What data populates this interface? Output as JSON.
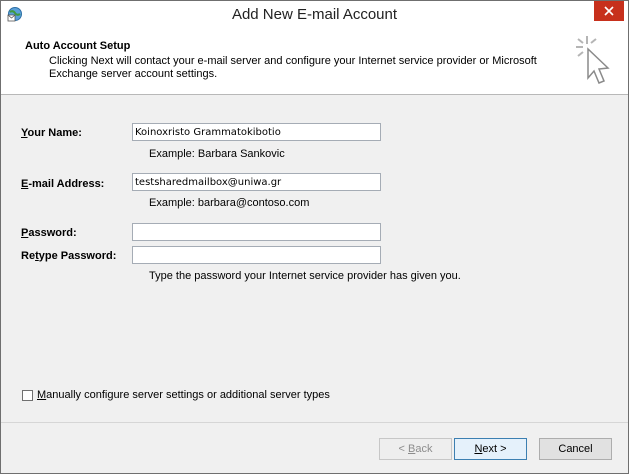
{
  "window": {
    "title": "Add New E-mail Account"
  },
  "header": {
    "title": "Auto Account Setup",
    "description": "Clicking Next will contact your e-mail server and configure your Internet service provider or Microsoft Exchange server account settings."
  },
  "form": {
    "name": {
      "label": "Your Name:",
      "value": "Koinoxristo Grammatokibotio",
      "hint": "Example: Barbara Sankovic"
    },
    "email": {
      "label": "E-mail Address:",
      "value": "testsharedmailbox@uniwa.gr",
      "hint": "Example: barbara@contoso.com"
    },
    "password": {
      "label": "Password:",
      "value": ""
    },
    "retype": {
      "label": "Retype Password:",
      "value": ""
    },
    "password_hint": "Type the password your Internet service provider has given you."
  },
  "manual": {
    "label": "Manually configure server settings or additional server types",
    "checked": false
  },
  "buttons": {
    "back": "< Back",
    "next": "Next >",
    "cancel": "Cancel"
  },
  "colors": {
    "close": "#c7301c",
    "default_button_border": "#3c7fb1"
  }
}
